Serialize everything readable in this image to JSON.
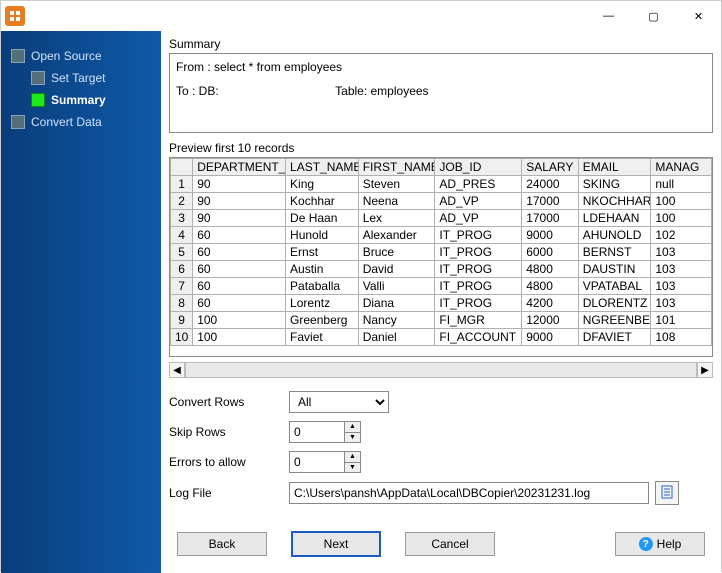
{
  "window": {
    "minimize_glyph": "—",
    "maximize_glyph": "▢",
    "close_glyph": "✕"
  },
  "sidebar": {
    "items": [
      {
        "label": "Open Source",
        "active": false,
        "indent": 0
      },
      {
        "label": "Set Target",
        "active": false,
        "indent": 1
      },
      {
        "label": "Summary",
        "active": true,
        "indent": 1
      },
      {
        "label": "Convert Data",
        "active": false,
        "indent": 0
      }
    ]
  },
  "summary": {
    "title": "Summary",
    "line1": "From : select * from employees",
    "line2_prefix": "To : DB:",
    "line2_suffix": "Table: employees"
  },
  "preview": {
    "title": "Preview first 10 records",
    "columns": [
      "DEPARTMENT_ID",
      "LAST_NAME",
      "FIRST_NAME",
      "JOB_ID",
      "SALARY",
      "EMAIL",
      "MANAG"
    ],
    "rows": [
      [
        "90",
        "King",
        "Steven",
        "AD_PRES",
        "24000",
        "SKING",
        "null"
      ],
      [
        "90",
        "Kochhar",
        "Neena",
        "AD_VP",
        "17000",
        "NKOCHHAR",
        "100"
      ],
      [
        "90",
        "De Haan",
        "Lex",
        "AD_VP",
        "17000",
        "LDEHAAN",
        "100"
      ],
      [
        "60",
        "Hunold",
        "Alexander",
        "IT_PROG",
        "9000",
        "AHUNOLD",
        "102"
      ],
      [
        "60",
        "Ernst",
        "Bruce",
        "IT_PROG",
        "6000",
        "BERNST",
        "103"
      ],
      [
        "60",
        "Austin",
        "David",
        "IT_PROG",
        "4800",
        "DAUSTIN",
        "103"
      ],
      [
        "60",
        "Pataballa",
        "Valli",
        "IT_PROG",
        "4800",
        "VPATABAL",
        "103"
      ],
      [
        "60",
        "Lorentz",
        "Diana",
        "IT_PROG",
        "4200",
        "DLORENTZ",
        "103"
      ],
      [
        "100",
        "Greenberg",
        "Nancy",
        "FI_MGR",
        "12000",
        "NGREENBE",
        "101"
      ],
      [
        "100",
        "Faviet",
        "Daniel",
        "FI_ACCOUNT",
        "9000",
        "DFAVIET",
        "108"
      ]
    ]
  },
  "form": {
    "convert_rows_label": "Convert Rows",
    "convert_rows_value": "All",
    "skip_rows_label": "Skip Rows",
    "skip_rows_value": "0",
    "errors_label": "Errors to allow",
    "errors_value": "0",
    "logfile_label": "Log File",
    "logfile_value": "C:\\Users\\pansh\\AppData\\Local\\DBCopier\\20231231.log"
  },
  "buttons": {
    "back": "Back",
    "next": "Next",
    "cancel": "Cancel",
    "help": "Help"
  }
}
